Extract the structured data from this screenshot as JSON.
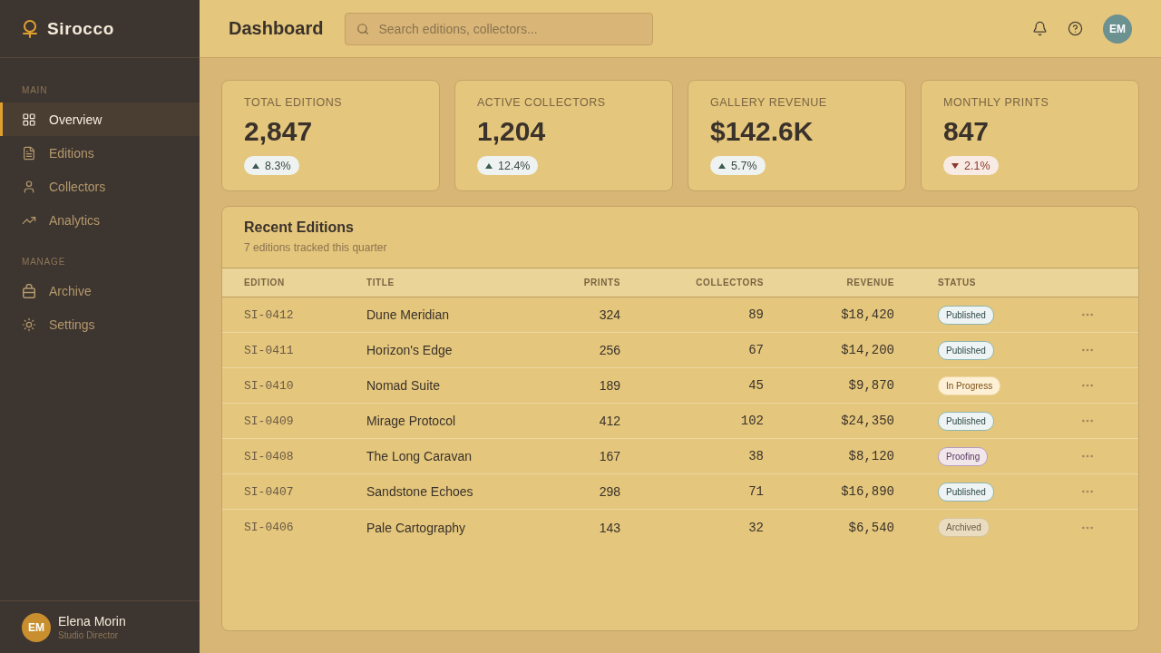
{
  "app": {
    "name": "Sirocco"
  },
  "sidebar": {
    "sections": [
      {
        "title": "MAIN",
        "items": [
          {
            "label": "Overview",
            "selected": true
          },
          {
            "label": "Editions",
            "selected": false
          },
          {
            "label": "Collectors",
            "selected": false
          },
          {
            "label": "Analytics",
            "selected": false
          }
        ]
      },
      {
        "title": "MANAGE",
        "items": [
          {
            "label": "Archive",
            "selected": false
          },
          {
            "label": "Settings",
            "selected": false
          }
        ]
      }
    ],
    "user": {
      "initials": "EM",
      "name": "Elena Morin",
      "role": "Studio Director"
    }
  },
  "header": {
    "title": "Dashboard",
    "search": {
      "placeholder": "Search editions, collectors..."
    },
    "avatar": "EM"
  },
  "stats": [
    {
      "label": "TOTAL EDITIONS",
      "value": "2,847",
      "trend": {
        "kind": "up",
        "text": "8.3%"
      }
    },
    {
      "label": "ACTIVE COLLECTORS",
      "value": "1,204",
      "trend": {
        "kind": "up",
        "text": "12.4%"
      }
    },
    {
      "label": "GALLERY REVENUE",
      "value": "$142.6K",
      "trend": {
        "kind": "up",
        "text": "5.7%"
      }
    },
    {
      "label": "MONTHLY PRINTS",
      "value": "847",
      "trend": {
        "kind": "down",
        "text": "2.1%"
      }
    }
  ],
  "recent_editions": {
    "title": "Recent Editions",
    "subtitle": "7 editions tracked this quarter",
    "columns": [
      "EDITION",
      "TITLE",
      "PRINTS",
      "COLLECTORS",
      "REVENUE",
      "STATUS"
    ],
    "rows": [
      {
        "edition": "SI-0412",
        "title": "Dune Meridian",
        "prints": "324",
        "collectors": "89",
        "revenue": "$18,420",
        "status": {
          "kind": "published",
          "label": "Published"
        }
      },
      {
        "edition": "SI-0411",
        "title": "Horizon's Edge",
        "prints": "256",
        "collectors": "67",
        "revenue": "$14,200",
        "status": {
          "kind": "published",
          "label": "Published"
        }
      },
      {
        "edition": "SI-0410",
        "title": "Nomad Suite",
        "prints": "189",
        "collectors": "45",
        "revenue": "$9,870",
        "status": {
          "kind": "in_progress",
          "label": "In Progress"
        }
      },
      {
        "edition": "SI-0409",
        "title": "Mirage Protocol",
        "prints": "412",
        "collectors": "102",
        "revenue": "$24,350",
        "status": {
          "kind": "published",
          "label": "Published"
        }
      },
      {
        "edition": "SI-0408",
        "title": "The Long Caravan",
        "prints": "167",
        "collectors": "38",
        "revenue": "$8,120",
        "status": {
          "kind": "proofing",
          "label": "Proofing"
        }
      },
      {
        "edition": "SI-0407",
        "title": "Sandstone Echoes",
        "prints": "298",
        "collectors": "71",
        "revenue": "$16,890",
        "status": {
          "kind": "published",
          "label": "Published"
        }
      },
      {
        "edition": "SI-0406",
        "title": "Pale Cartography",
        "prints": "143",
        "collectors": "32",
        "revenue": "$6,540",
        "status": {
          "kind": "archived",
          "label": "Archived"
        }
      }
    ]
  }
}
